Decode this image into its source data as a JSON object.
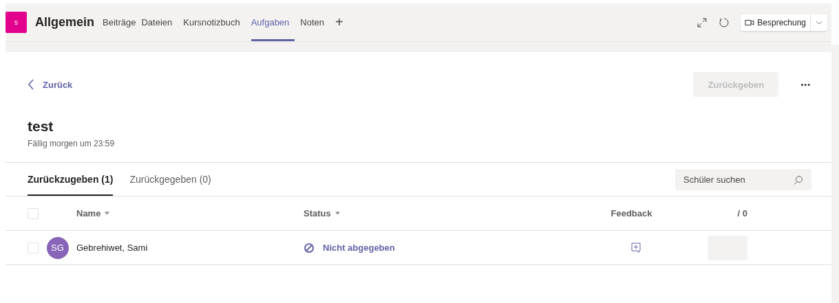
{
  "channel": {
    "team_badge": "5",
    "name": "Allgemein"
  },
  "tabs": [
    {
      "label": "Beiträge",
      "selected": false
    },
    {
      "label": "Dateien",
      "selected": false
    },
    {
      "label": "Kursnotizbuch",
      "selected": false
    },
    {
      "label": "Aufgaben",
      "selected": true
    },
    {
      "label": "Noten",
      "selected": false
    },
    {
      "label": "+",
      "selected": false
    }
  ],
  "meeting_button": {
    "label": "Besprechung"
  },
  "back_link": "Zurück",
  "return_button": {
    "label": "Zurückgeben",
    "disabled": true
  },
  "more_button": "•••",
  "assignment": {
    "title": "test",
    "due": "Fällig morgen um 23:59"
  },
  "sub_tabs": [
    {
      "label": "Zurückzugeben (1)",
      "selected": true
    },
    {
      "label": "Zurückgegeben (0)",
      "selected": false
    }
  ],
  "search": {
    "placeholder": "Schüler suchen"
  },
  "select_all_checked": false,
  "table": {
    "columns": [
      {
        "label": "Name",
        "sortable": true
      },
      {
        "label": "Status",
        "sortable": true
      },
      {
        "label": "Feedback",
        "sortable": false
      },
      {
        "label": "/ 0",
        "sortable": false
      }
    ],
    "rows": [
      {
        "checked": false,
        "initials": "SG",
        "color": "#8764b8",
        "name": "Gebrehiwet, Sami",
        "status": "Nicht abgegeben"
      }
    ]
  }
}
